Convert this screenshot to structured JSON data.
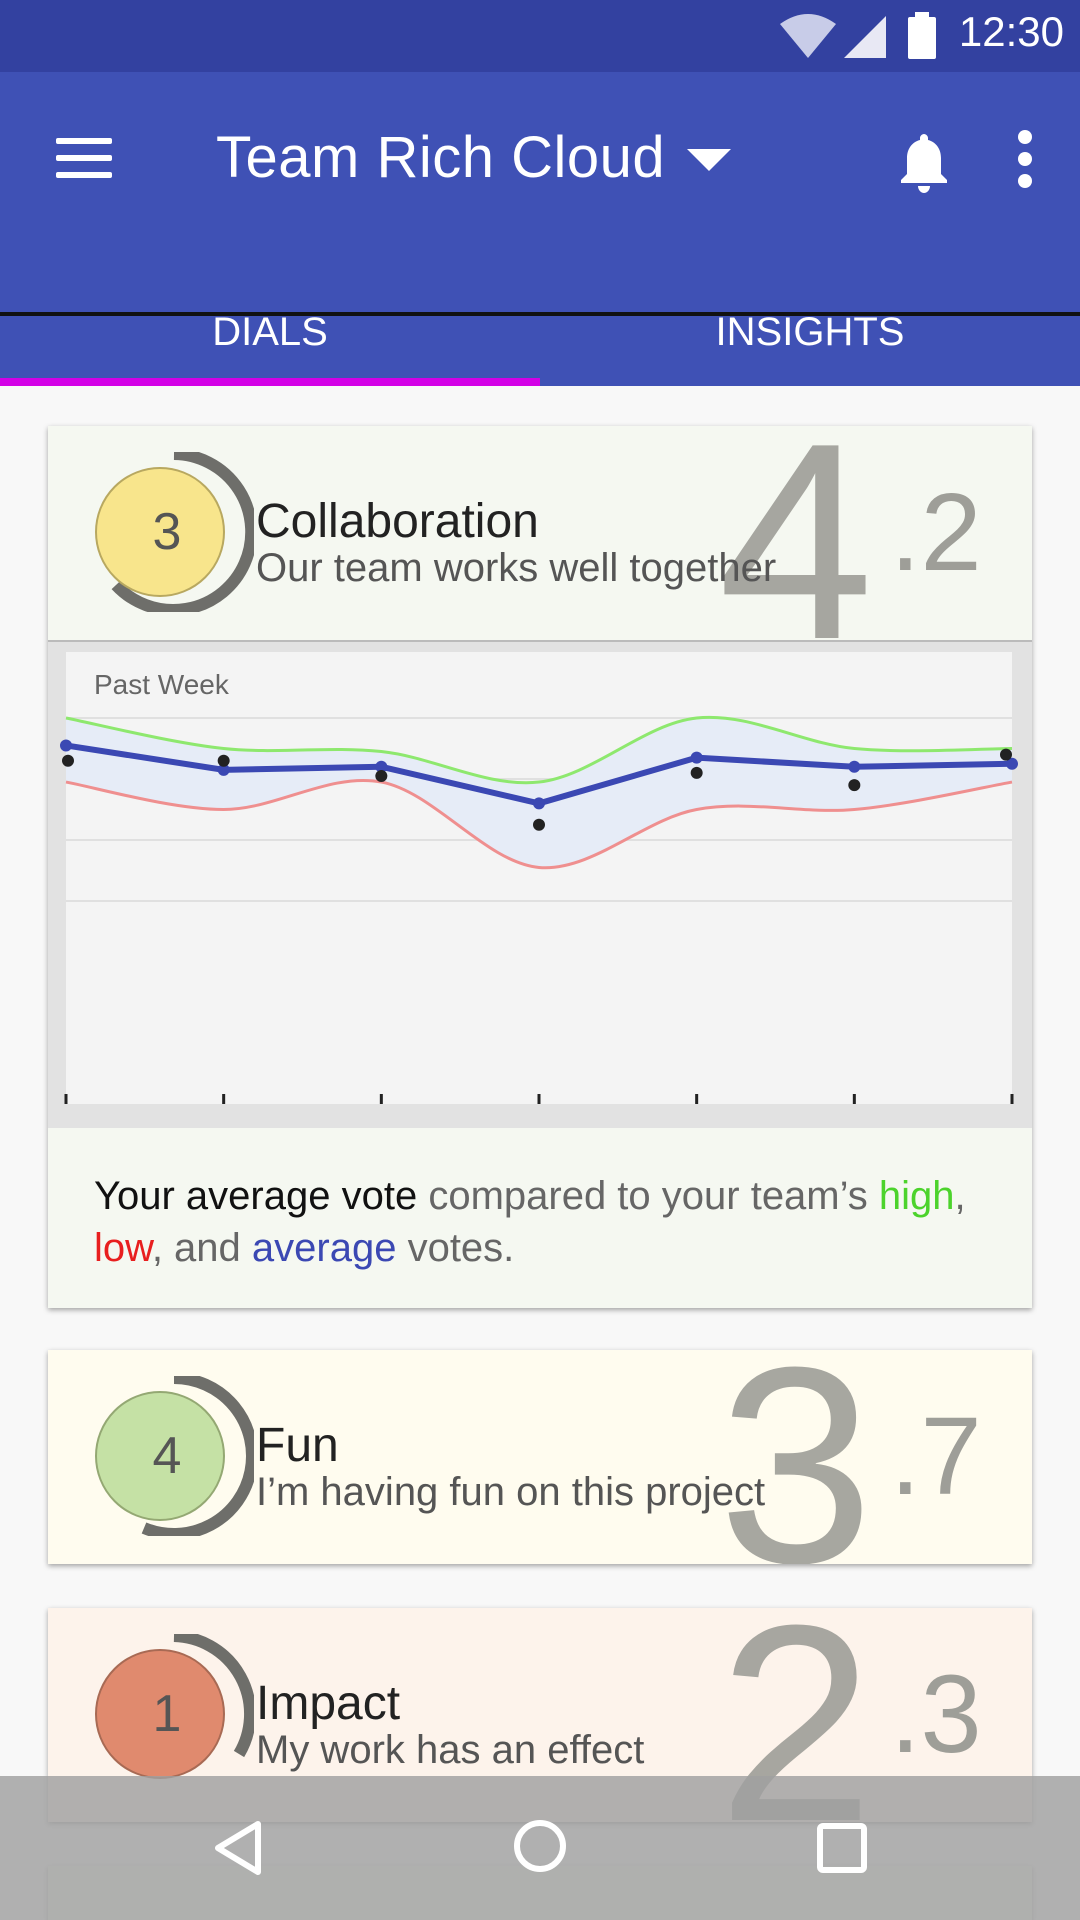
{
  "status_bar": {
    "time": "12:30"
  },
  "app_bar": {
    "title": "Team Rich Cloud",
    "tabs": [
      {
        "label": "DIALS",
        "active": true
      },
      {
        "label": "INSIGHTS",
        "active": false
      }
    ]
  },
  "cards": [
    {
      "dial_value": "3",
      "title": "Collaboration",
      "description": "Our team works well together",
      "score_int": "4",
      "score_dec": ".2",
      "bg": "#f5f8f1",
      "dial_color": "#f8e58c",
      "expanded": true
    },
    {
      "dial_value": "4",
      "title": "Fun",
      "description": "I’m having fun on this project",
      "score_int": "3",
      "score_dec": ".7",
      "bg": "#fffcef",
      "dial_color": "#c5e1a5"
    },
    {
      "dial_value": "1",
      "title": "Impact",
      "description": "My work has an effect",
      "score_int": "2",
      "score_dec": ".3",
      "bg": "#fdf3eb",
      "dial_color": "#e08a6e"
    }
  ],
  "legend": {
    "part1": "Your average vote",
    "part2": " compared to your team’s ",
    "high": "high",
    "comma": ",",
    "low": "low",
    "and": ", and ",
    "average": "average",
    "end": " votes."
  },
  "chart_data": {
    "type": "line",
    "title": "Past Week",
    "x": [
      1,
      2,
      3,
      4,
      5,
      6,
      7
    ],
    "ylim": [
      0,
      5
    ],
    "grid": true,
    "series": [
      {
        "name": "high",
        "color": "#8ee86e",
        "values": [
          4.0,
          3.5,
          3.45,
          2.95,
          4.0,
          3.5,
          3.5
        ]
      },
      {
        "name": "low",
        "color": "#ef8f8f",
        "values": [
          2.95,
          2.5,
          2.95,
          1.55,
          2.5,
          2.5,
          2.95
        ]
      },
      {
        "name": "average",
        "color": "#3b48b3",
        "values": [
          3.55,
          3.15,
          3.2,
          2.6,
          3.35,
          3.2,
          3.25
        ]
      },
      {
        "name": "your vote",
        "color": "#222222",
        "values": [
          3.3,
          3.3,
          3.05,
          2.25,
          3.1,
          2.9,
          3.4
        ]
      }
    ]
  }
}
